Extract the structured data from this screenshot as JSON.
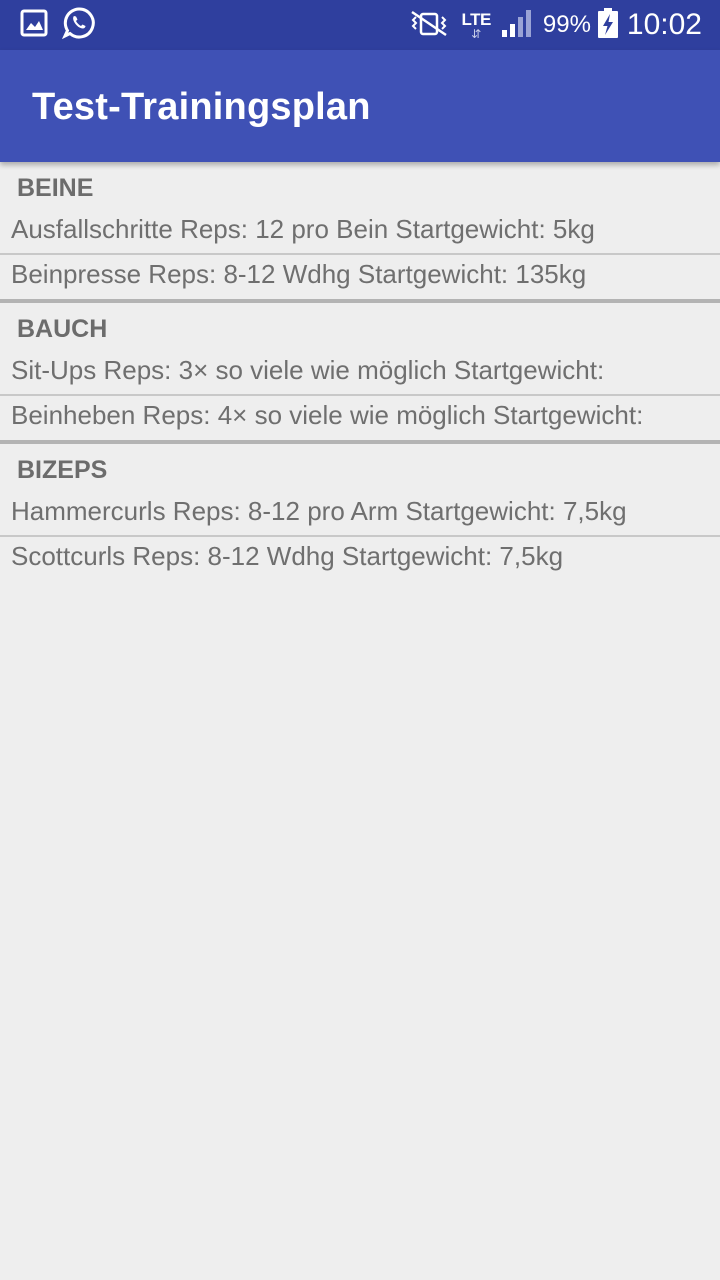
{
  "status_bar": {
    "network_type": "LTE",
    "network_arrows": "⇵",
    "battery_percent": "99%",
    "time": "10:02",
    "left_icons": [
      "gallery-notification-icon",
      "whatsapp-icon"
    ],
    "right_icons": [
      "vibrate-icon",
      "lte-icon",
      "signal-icon",
      "battery-charging-icon"
    ]
  },
  "app_bar": {
    "title": "Test-Trainingsplan"
  },
  "groups": [
    {
      "header": "BEINE",
      "items": [
        "Ausfallschritte Reps: 12 pro Bein Startgewicht: 5kg",
        "Beinpresse Reps: 8-12 Wdhg Startgewicht: 135kg"
      ]
    },
    {
      "header": "BAUCH",
      "items": [
        "Sit-Ups Reps: 3× so viele wie möglich Startgewicht:",
        "Beinheben Reps: 4× so viele wie möglich Startgewicht:"
      ]
    },
    {
      "header": "BIZEPS",
      "items": [
        "Hammercurls Reps: 8-12 pro Arm Startgewicht: 7,5kg",
        "Scottcurls Reps: 8-12 Wdhg Startgewicht: 7,5kg"
      ]
    }
  ],
  "colors": {
    "status_bar": "#2f3f9e",
    "app_bar": "#3f51b5",
    "background": "#eeeeee",
    "text": "#6f6f6f"
  }
}
